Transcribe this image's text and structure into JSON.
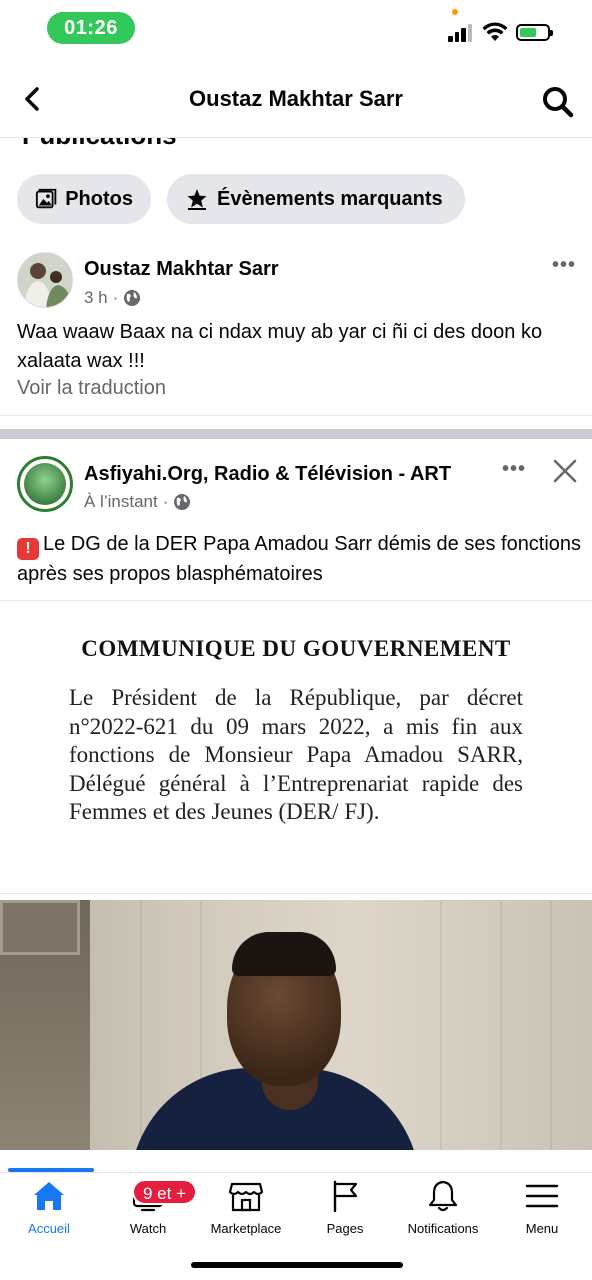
{
  "status_bar": {
    "time": "01:26"
  },
  "header": {
    "title": "Oustaz Makhtar Sarr"
  },
  "section_peek": "Publications",
  "chips": [
    {
      "label": "Photos",
      "icon": "photo-icon"
    },
    {
      "label": "Évènements marquants",
      "icon": "star-icon"
    }
  ],
  "post1": {
    "author": "Oustaz Makhtar Sarr",
    "time": "3 h",
    "text": "Waa waaw Baax na ci ndax muy ab yar ci ñi ci des doon ko xalaata wax !!!",
    "see_translation": "Voir la traduction"
  },
  "post2": {
    "author": "Asfiyahi.Org, Radio & Télévision - ART",
    "time": "À l’instant",
    "text": "Le DG de la DER Papa Amadou Sarr démis de ses fonctions après ses propos blasphématoires",
    "communique": {
      "title": "COMMUNIQUE DU GOUVERNEMENT",
      "body": "Le Président de la République, par décret n°2022-621 du 09 mars 2022, a mis fin aux fonctions de Monsieur Papa Amadou SARR, Délégué général à l’Entreprenariat rapide des Femmes et des Jeunes (DER/ FJ)."
    }
  },
  "tabbar": {
    "watch_badge": "9 et +",
    "items": [
      {
        "label": "Accueil",
        "icon": "home-icon",
        "active": true
      },
      {
        "label": "Watch",
        "icon": "watch-icon",
        "active": false
      },
      {
        "label": "Marketplace",
        "icon": "marketplace-icon",
        "active": false
      },
      {
        "label": "Pages",
        "icon": "flag-icon",
        "active": false
      },
      {
        "label": "Notifications",
        "icon": "bell-icon",
        "active": false
      },
      {
        "label": "Menu",
        "icon": "menu-icon",
        "active": false
      }
    ]
  },
  "colors": {
    "accent": "#1877f2",
    "badge": "#e41e3f",
    "chip_bg": "#e4e6eb",
    "status_green": "#34c759"
  }
}
